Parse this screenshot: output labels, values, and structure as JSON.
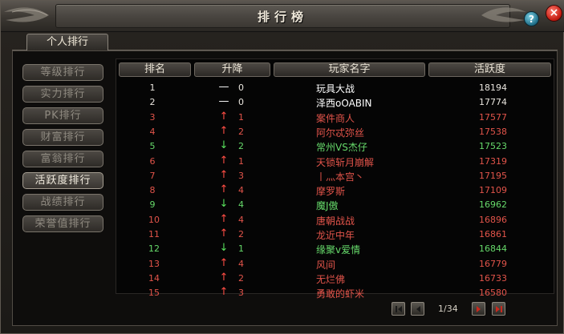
{
  "window": {
    "title": "排行榜"
  },
  "tabs": [
    {
      "label": "个人排行"
    }
  ],
  "sidebar": {
    "items": [
      {
        "label": "等级排行"
      },
      {
        "label": "实力排行"
      },
      {
        "label": "PK排行"
      },
      {
        "label": "财富排行"
      },
      {
        "label": "富翁排行"
      },
      {
        "label": "活跃度排行",
        "active": true
      },
      {
        "label": "战绩排行"
      },
      {
        "label": "荣誉值排行"
      }
    ]
  },
  "table": {
    "headers": {
      "rank": "排名",
      "change": "升降",
      "player": "玩家名字",
      "activity": "活跃度"
    },
    "rows": [
      {
        "rank": "1",
        "trend": "flat",
        "delta": "0",
        "name": "玩具大战",
        "score": "18194",
        "color": "white"
      },
      {
        "rank": "2",
        "trend": "flat",
        "delta": "0",
        "name": "泽西oOABIN",
        "score": "17774",
        "color": "white"
      },
      {
        "rank": "3",
        "trend": "up",
        "delta": "1",
        "name": "案件商人",
        "score": "17577",
        "color": "red"
      },
      {
        "rank": "4",
        "trend": "up",
        "delta": "2",
        "name": "阿尔忒弥丝",
        "score": "17538",
        "color": "red"
      },
      {
        "rank": "5",
        "trend": "down",
        "delta": "2",
        "name": "常州VS杰仔",
        "score": "17523",
        "color": "green"
      },
      {
        "rank": "6",
        "trend": "up",
        "delta": "1",
        "name": "天锁斩月崩解",
        "score": "17319",
        "color": "red"
      },
      {
        "rank": "7",
        "trend": "up",
        "delta": "3",
        "name": "丨灬本宫丶",
        "score": "17195",
        "color": "red"
      },
      {
        "rank": "8",
        "trend": "up",
        "delta": "4",
        "name": "摩罗斯",
        "score": "17109",
        "color": "red"
      },
      {
        "rank": "9",
        "trend": "down",
        "delta": "4",
        "name": "魔J傲",
        "score": "16962",
        "color": "green"
      },
      {
        "rank": "10",
        "trend": "up",
        "delta": "4",
        "name": "唐朝战战",
        "score": "16896",
        "color": "red"
      },
      {
        "rank": "11",
        "trend": "up",
        "delta": "2",
        "name": "龙近中年",
        "score": "16861",
        "color": "red"
      },
      {
        "rank": "12",
        "trend": "down",
        "delta": "1",
        "name": "缘聚v爱情",
        "score": "16844",
        "color": "green"
      },
      {
        "rank": "13",
        "trend": "up",
        "delta": "4",
        "name": "风间",
        "score": "16779",
        "color": "red"
      },
      {
        "rank": "14",
        "trend": "up",
        "delta": "2",
        "name": "无烂佛",
        "score": "16733",
        "color": "red"
      },
      {
        "rank": "15",
        "trend": "up",
        "delta": "3",
        "name": "勇敢的虾米",
        "score": "16580",
        "color": "red"
      }
    ]
  },
  "pagination": {
    "text": "1/34"
  },
  "icons": {
    "help": "?",
    "close": "×",
    "up": "↑",
    "down": "↓",
    "flat": "—"
  },
  "colors": {
    "red": "#e2544a",
    "green": "#66d96a",
    "white": "#e9e5de"
  }
}
